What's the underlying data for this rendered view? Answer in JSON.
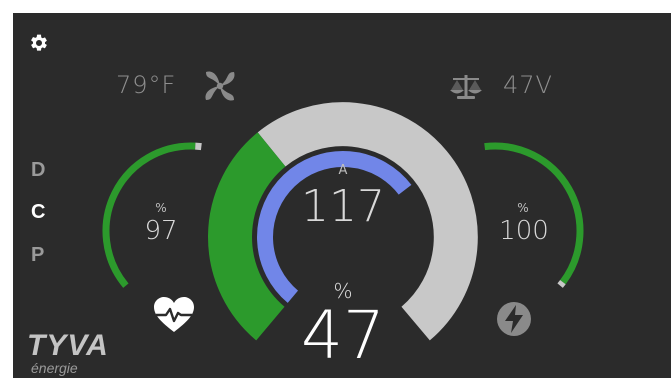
{
  "colors": {
    "background": "#2b2b2b",
    "green": "#2c9a2c",
    "gray_track": "#c8c8c8",
    "blue": "#7186e8",
    "mode_active": "#ffffff",
    "mode_inactive": "#9a9a9a"
  },
  "toolbar": {
    "settings_icon": "gear-icon"
  },
  "modes": [
    {
      "label": "D",
      "active": false
    },
    {
      "label": "C",
      "active": true
    },
    {
      "label": "P",
      "active": false
    }
  ],
  "temperature": {
    "value": "79°F",
    "icon": "fan-icon"
  },
  "voltage": {
    "value": "47V",
    "icon": "balance-scale-icon"
  },
  "health": {
    "unit": "%",
    "value": "97",
    "level": 0.97,
    "icon": "heart-pulse-icon"
  },
  "power": {
    "unit": "%",
    "value": "100",
    "level": 1.0,
    "icon": "lightning-bolt-icon"
  },
  "current": {
    "unit": "A",
    "value": "117",
    "level": 0.94
  },
  "battery": {
    "unit": "%",
    "value": "47",
    "level": 0.36
  },
  "brand": {
    "name": "TYVA",
    "subtitle": "énergie"
  }
}
